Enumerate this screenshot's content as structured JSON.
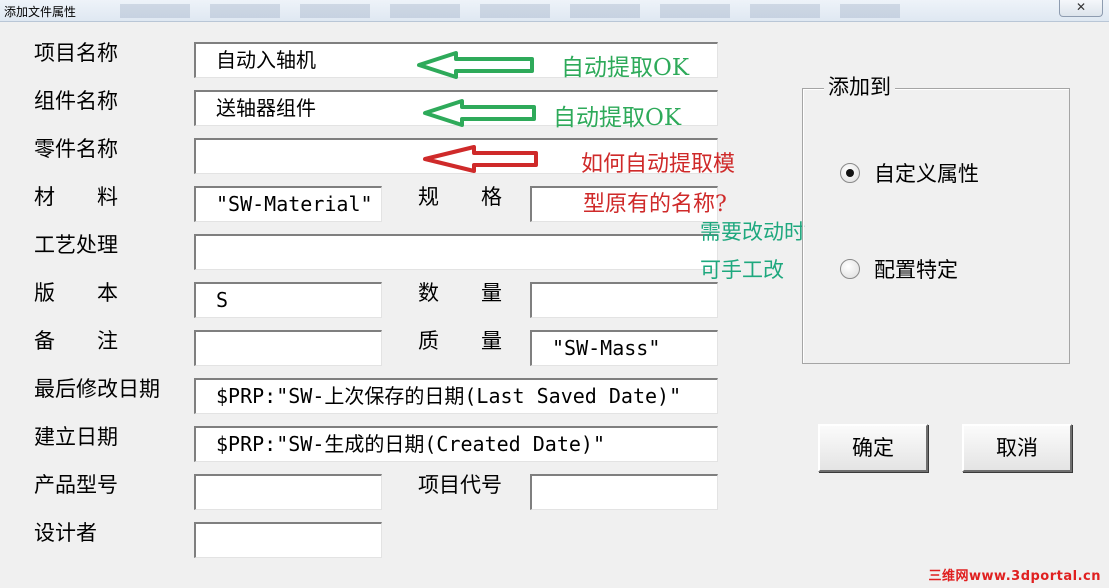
{
  "window": {
    "title": "添加文件属性",
    "close": "✕"
  },
  "labels": {
    "project_name": "项目名称",
    "component_name": "组件名称",
    "part_name": "零件名称",
    "material": "材　　料",
    "spec": "规　　格",
    "process": "工艺处理",
    "version": "版　　本",
    "quantity": "数　　量",
    "remark": "备　　注",
    "mass": "质　　量",
    "last_modified": "最后修改日期",
    "created_date": "建立日期",
    "product_model": "产品型号",
    "project_code": "项目代号",
    "designer": "设计者"
  },
  "values": {
    "project_name": "自动入轴机",
    "component_name": "送轴器组件",
    "part_name": "",
    "material": "\"SW-Material\"",
    "spec": "",
    "process": "",
    "version": "S",
    "quantity": "",
    "remark": "",
    "mass": "\"SW-Mass\"",
    "last_modified": "$PRP:\"SW-上次保存的日期(Last Saved Date)\"",
    "created_date": "$PRP:\"SW-生成的日期(Created Date)\"",
    "product_model": "",
    "project_code": "",
    "designer": ""
  },
  "annotations": {
    "ok1": "自动提取OK",
    "ok2": "自动提取OK",
    "question_line1": "如何自动提取模",
    "question_line2": "型原有的名称?",
    "note_line1": "需要改动时",
    "note_line2": "可手工改"
  },
  "add_to": {
    "title": "添加到",
    "options": [
      {
        "label": "自定义属性",
        "selected": true
      },
      {
        "label": "配置特定",
        "selected": false
      }
    ]
  },
  "buttons": {
    "ok": "确定",
    "cancel": "取消"
  },
  "watermark": "三维网www.3dportal.cn",
  "colors": {
    "arrow_green": "#2eaa5a",
    "arrow_red": "#cf2a2a"
  }
}
